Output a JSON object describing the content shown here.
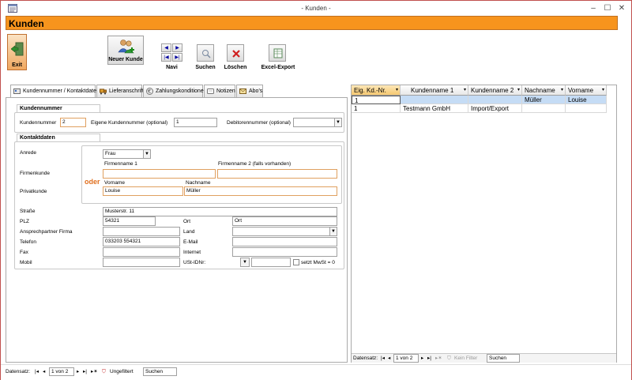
{
  "window": {
    "title": "- Kunden -",
    "min": "–",
    "max": "☐",
    "close": "✕"
  },
  "header": {
    "title": "Kunden"
  },
  "toolbar": {
    "exit": "Exit",
    "neuer_kunde": "Neuer Kunde",
    "navi": "Navi",
    "suchen": "Suchen",
    "loeschen": "Löschen",
    "excel_export": "Excel-Export"
  },
  "tabs": [
    {
      "label": "Kundennummer / Kontaktdaten"
    },
    {
      "label": "Lieferanschrift"
    },
    {
      "label": "Zahlungskonditionen"
    },
    {
      "label": "Notizen"
    },
    {
      "label": "Abo's"
    }
  ],
  "kundennummer_section": {
    "title": "Kundennummer",
    "kundennummer_label": "Kundennummer",
    "kundennummer_value": "2",
    "eigene_label": "Eigene Kundennummer (optional)",
    "eigene_value": "1",
    "debitor_label": "Debitorennummer (optional)",
    "debitor_value": ""
  },
  "kontakt_section": {
    "title": "Kontaktdaten",
    "anrede_label": "Anrede",
    "anrede_value": "Frau",
    "firmenname1_label": "Firmenname 1",
    "firmenname2_label": "Firmenname 2  (falls vorhanden)",
    "firmenkunde_label": "Firmenkunde",
    "oder": "oder",
    "vorname_label": "Vorname",
    "nachname_label": "Nachname",
    "privatkunde_label": "Privatkunde",
    "vorname_value": "Louise",
    "nachname_value": "Müller",
    "strasse_label": "Straße",
    "strasse_value": "Musterstr. 11",
    "plz_label": "PLZ",
    "plz_value": "54321",
    "ort_label": "Ort",
    "ort_value": "Ort",
    "ansprech_label": "Ansprechpartner Firma",
    "land_label": "Land",
    "telefon_label": "Telefon",
    "telefon_value": "033203 554321",
    "email_label": "E-Mail",
    "fax_label": "Fax",
    "internet_label": "Internet",
    "mobil_label": "Mobil",
    "ustid_label": "USt-IDNr:",
    "mwst_label": "setzt MwSt = 0"
  },
  "grid": {
    "columns": [
      "Eig. Kd.-Nr.",
      "Kundenname 1",
      "Kundenname 2",
      "Nachname",
      "Vorname"
    ],
    "rows": [
      [
        "1",
        "",
        "",
        "Müller",
        "Louise"
      ],
      [
        "1",
        "Testmann GmbH",
        "Import/Export",
        "",
        ""
      ]
    ]
  },
  "grid_nav": {
    "label": "Datensatz:",
    "position": "1 von 2",
    "filter": "Kein Filter",
    "search": "Suchen"
  },
  "status_nav": {
    "label": "Datensatz:",
    "position": "1 von 2",
    "filter": "Ungefiltert",
    "search": "Suchen"
  }
}
